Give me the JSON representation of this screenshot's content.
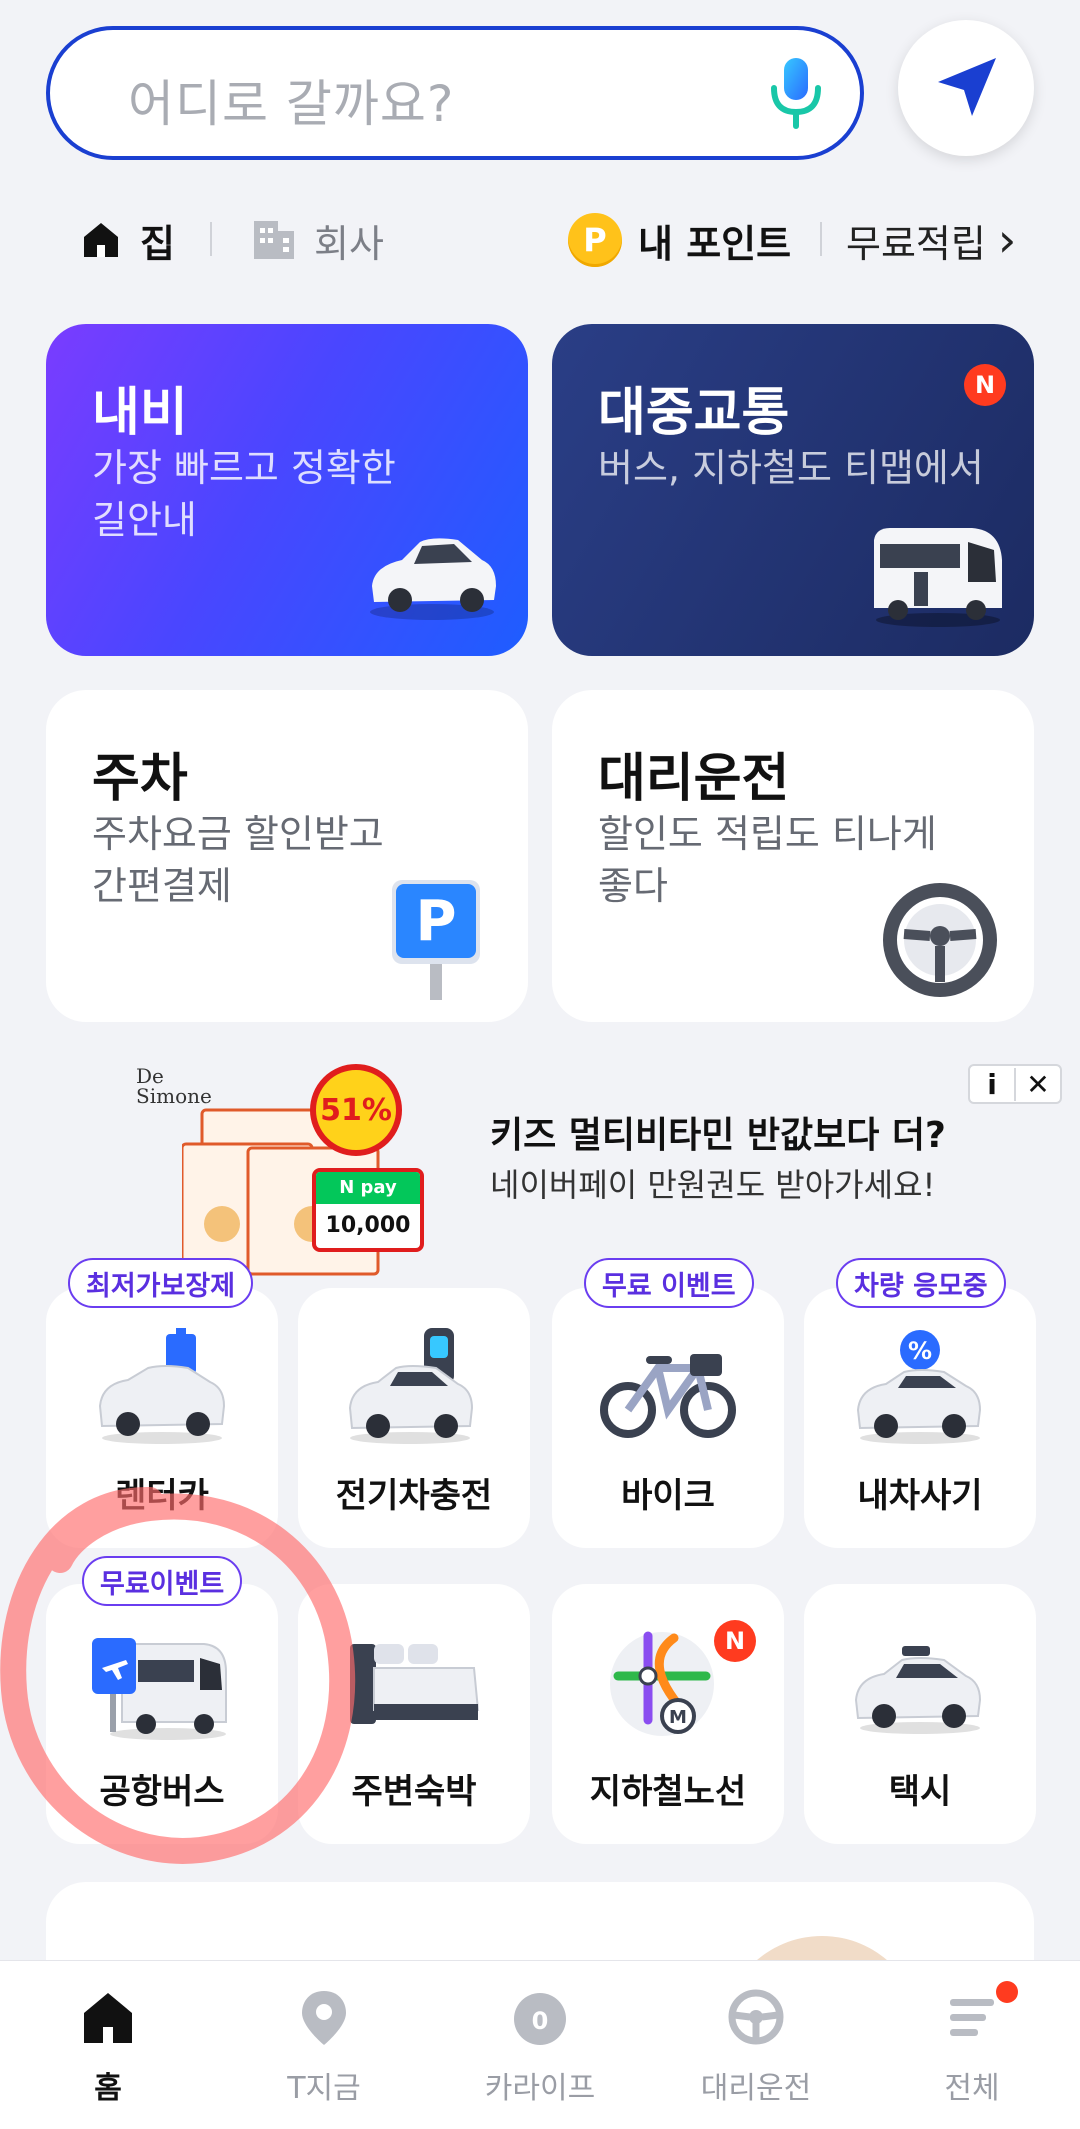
{
  "search": {
    "placeholder": "어디로 갈까요?"
  },
  "shortcuts": {
    "home": "집",
    "work": "회사",
    "points_coin": "P",
    "points": "내 포인트",
    "free_earn": "무료적립",
    "chevron": "›"
  },
  "cards": [
    {
      "title": "내비",
      "desc": "가장 빠르고 정확한 길안내"
    },
    {
      "title": "대중교통",
      "desc": "버스, 지하철도 티맵에서",
      "badge": "N"
    },
    {
      "title": "주차",
      "desc": "주차요금 할인받고 간편결제"
    },
    {
      "title": "대리운전",
      "desc": "할인도 적립도 티나게 좋다"
    }
  ],
  "ad": {
    "brand": "De Simone",
    "discount": "51%",
    "npay": "N pay",
    "coupon": "10,000원",
    "headline": "키즈 멀티비타민 반값보다 더?",
    "sub": "네이버페이 만원권도 받아가세요!",
    "info": "i",
    "close": "✕"
  },
  "services": [
    {
      "label": "렌터카",
      "tag": "최저가보장제"
    },
    {
      "label": "전기차충전"
    },
    {
      "label": "바이크",
      "tag": "무료 이벤트"
    },
    {
      "label": "내차사기",
      "tag": "차량 응모중"
    },
    {
      "label": "공항버스",
      "tag": "무료이벤트"
    },
    {
      "label": "주변숙박"
    },
    {
      "label": "지하철노선",
      "badge": "N"
    },
    {
      "label": "택시"
    }
  ],
  "tabs": [
    {
      "label": "홈"
    },
    {
      "label": "T지금"
    },
    {
      "label": "카라이프",
      "icon_text": "0"
    },
    {
      "label": "대리운전"
    },
    {
      "label": "전체"
    }
  ],
  "colors": {
    "accent": "#1a3fd1",
    "tag": "#6a3df0",
    "badge": "#ff3b1f",
    "annotation": "#ff6b6b"
  }
}
